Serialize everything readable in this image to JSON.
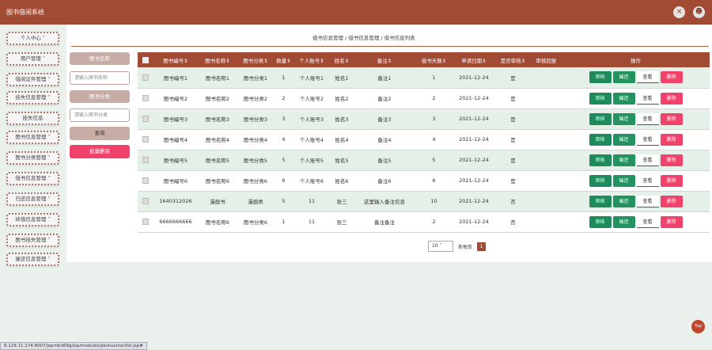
{
  "app": {
    "title": "图书借阅系统"
  },
  "header": {
    "close_icon": "×",
    "user_icon": "☻"
  },
  "sidebar": {
    "items": [
      {
        "label": "个人中心 ˅"
      },
      {
        "label": "用户管理 ˅"
      },
      {
        "label": "借阅证件管理 ˅"
      },
      {
        "label": "挂失信息管理 ˅"
      },
      {
        "label": "挂失信息"
      },
      {
        "label": "图书信息管理 ˅"
      },
      {
        "label": "图书分类管理 ˅"
      },
      {
        "label": "借书信息管理 ˅"
      },
      {
        "label": "归还信息管理 ˅"
      },
      {
        "label": "续借信息管理 ˅"
      },
      {
        "label": "图书挂失管理 ˅"
      },
      {
        "label": "催还信息管理 ˅"
      }
    ]
  },
  "breadcrumb": {
    "text": "借书信息管理 / 借书信息管理 / 借书信息列表"
  },
  "search": {
    "book_name_label": "图书名称",
    "book_name_placeholder": "请输入图书名称",
    "book_category_label": "图书分类",
    "book_category_placeholder": "请输入图书分类",
    "query_label": "查询",
    "batch_delete_label": "批量删除"
  },
  "table": {
    "columns": [
      "图书编号⇕",
      "图书名称⇕",
      "图书分类⇕",
      "数量⇕",
      "个人账号⇕",
      "姓名⇕",
      "备注⇕",
      "借书天数⇕",
      "申请日期⇕",
      "是否审核⇕",
      "审核回复",
      "操作"
    ],
    "actions": {
      "audit": "审核",
      "return": "催还",
      "view": "查看",
      "delete": "删除"
    },
    "rows": [
      [
        "图书编号1",
        "图书名称1",
        "图书分类1",
        "1",
        "个人账号1",
        "姓名1",
        "备注1",
        "1",
        "2021-12-24",
        "是",
        ""
      ],
      [
        "图书编号2",
        "图书名称2",
        "图书分类2",
        "2",
        "个人账号2",
        "姓名2",
        "备注2",
        "2",
        "2021-12-24",
        "是",
        ""
      ],
      [
        "图书编号3",
        "图书名称3",
        "图书分类3",
        "3",
        "个人账号3",
        "姓名3",
        "备注3",
        "3",
        "2021-12-24",
        "是",
        ""
      ],
      [
        "图书编号4",
        "图书名称4",
        "图书分类4",
        "4",
        "个人账号4",
        "姓名4",
        "备注4",
        "4",
        "2021-12-24",
        "是",
        ""
      ],
      [
        "图书编号5",
        "图书名称5",
        "图书分类5",
        "5",
        "个人账号5",
        "姓名5",
        "备注5",
        "5",
        "2021-12-24",
        "是",
        ""
      ],
      [
        "图书编号6",
        "图书名称6",
        "图书分类6",
        "6",
        "个人账号6",
        "姓名6",
        "备注6",
        "6",
        "2021-12-24",
        "是",
        ""
      ],
      [
        "1640312026",
        "漫画书",
        "漫画类",
        "5",
        "11",
        "张三",
        "这里输入备注信息",
        "10",
        "2021-12-24",
        "否",
        ""
      ],
      [
        "6666666666",
        "图书名称6",
        "图书分类6",
        "1",
        "11",
        "张三",
        "备注备注",
        "2",
        "2021-12-24",
        "否",
        ""
      ]
    ]
  },
  "pagination": {
    "page_size": "10",
    "per_page_label": "条每页",
    "current_page": "1"
  },
  "top_button": {
    "label": "Top"
  },
  "status": {
    "url": "8.129.11.174:8007/jsprnb369g/jsp/modules/jieshuxinxi/list.jsp#"
  },
  "colors": {
    "primary": "#a14a34",
    "accent_green": "#1f8a5b",
    "danger": "#f0426a",
    "row_tint": "#e5f0e8"
  }
}
